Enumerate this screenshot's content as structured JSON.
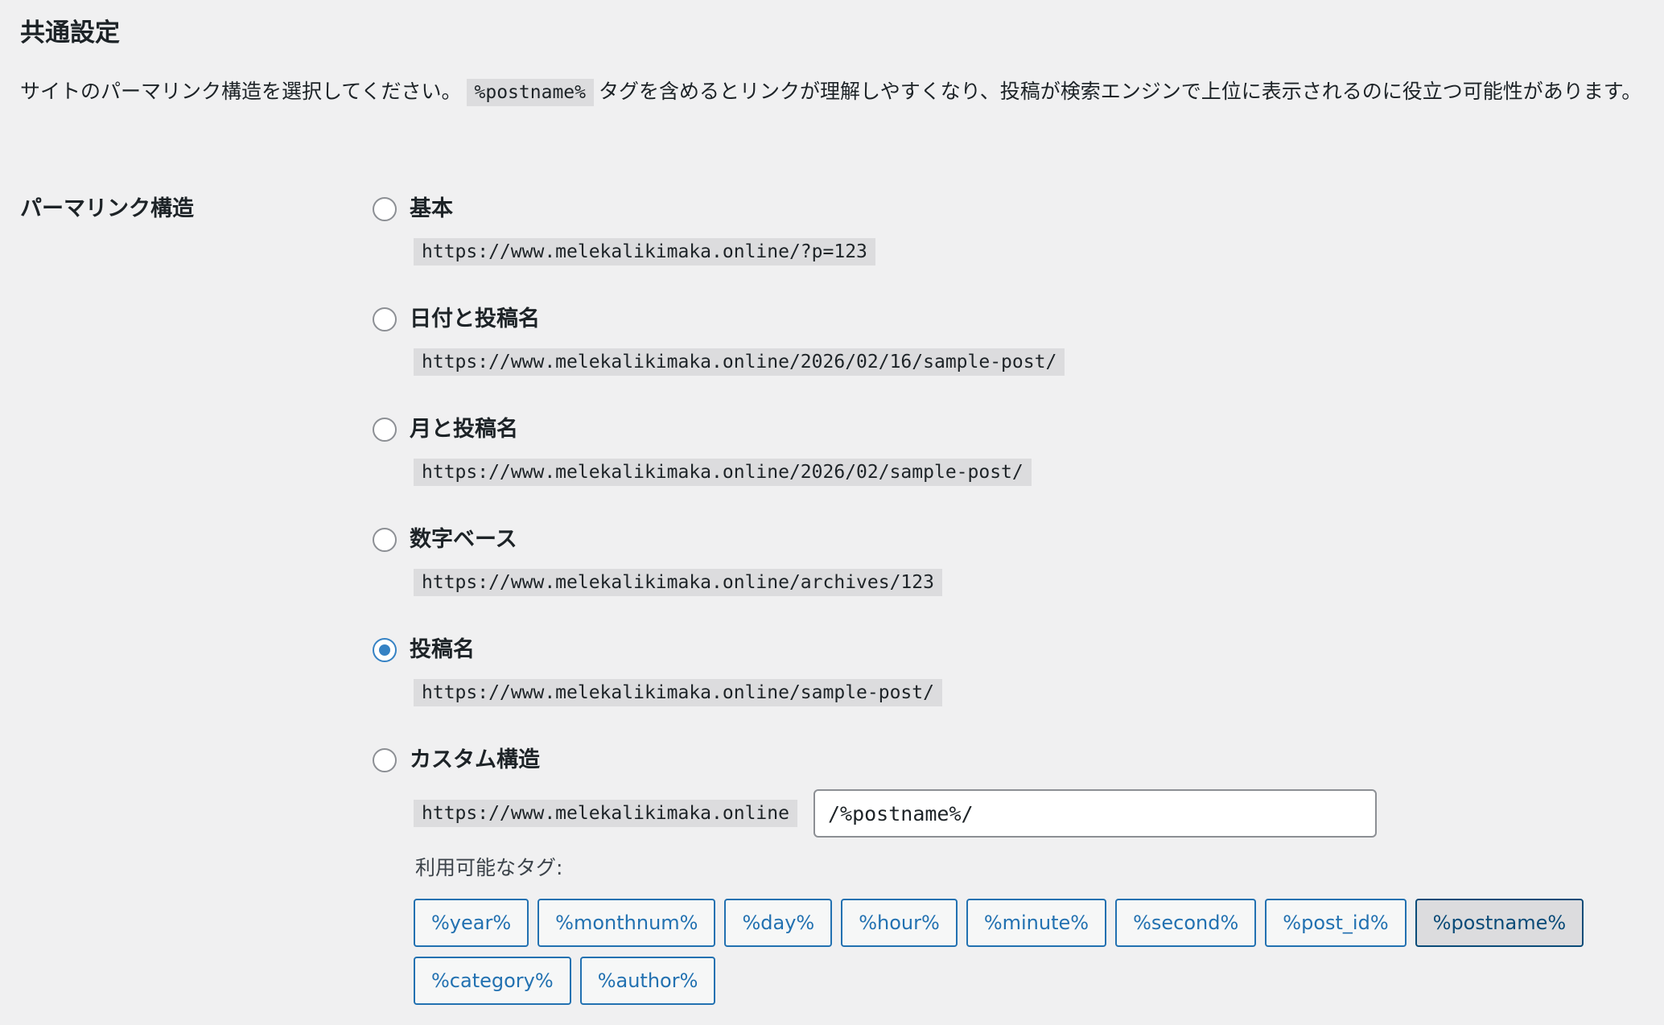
{
  "section": {
    "title": "共通設定",
    "intro_before": "サイトのパーマリンク構造を選択してください。",
    "intro_code": "%postname%",
    "intro_after": "タグを含めるとリンクが理解しやすくなり、投稿が検索エンジンで上位に表示されるのに役立つ可能性があります。"
  },
  "permalink": {
    "row_label": "パーマリンク構造",
    "options": [
      {
        "label": "基本",
        "example": "https://www.melekalikimaka.online/?p=123",
        "checked": false
      },
      {
        "label": "日付と投稿名",
        "example": "https://www.melekalikimaka.online/2026/02/16/sample-post/",
        "checked": false
      },
      {
        "label": "月と投稿名",
        "example": "https://www.melekalikimaka.online/2026/02/sample-post/",
        "checked": false
      },
      {
        "label": "数字ベース",
        "example": "https://www.melekalikimaka.online/archives/123",
        "checked": false
      },
      {
        "label": "投稿名",
        "example": "https://www.melekalikimaka.online/sample-post/",
        "checked": true
      }
    ],
    "custom": {
      "label": "カスタム構造",
      "base_url": "https://www.melekalikimaka.online",
      "value": "/%postname%/",
      "checked": false
    },
    "tags_label": "利用可能なタグ:",
    "tags": [
      "%year%",
      "%monthnum%",
      "%day%",
      "%hour%",
      "%minute%",
      "%second%",
      "%post_id%",
      "%postname%",
      "%category%",
      "%author%"
    ],
    "active_tag": "%postname%"
  },
  "colors": {
    "background": "#f0f0f1",
    "accent": "#2271b1",
    "radio_checked": "#3582c4",
    "code_background": "#dcdcde"
  }
}
